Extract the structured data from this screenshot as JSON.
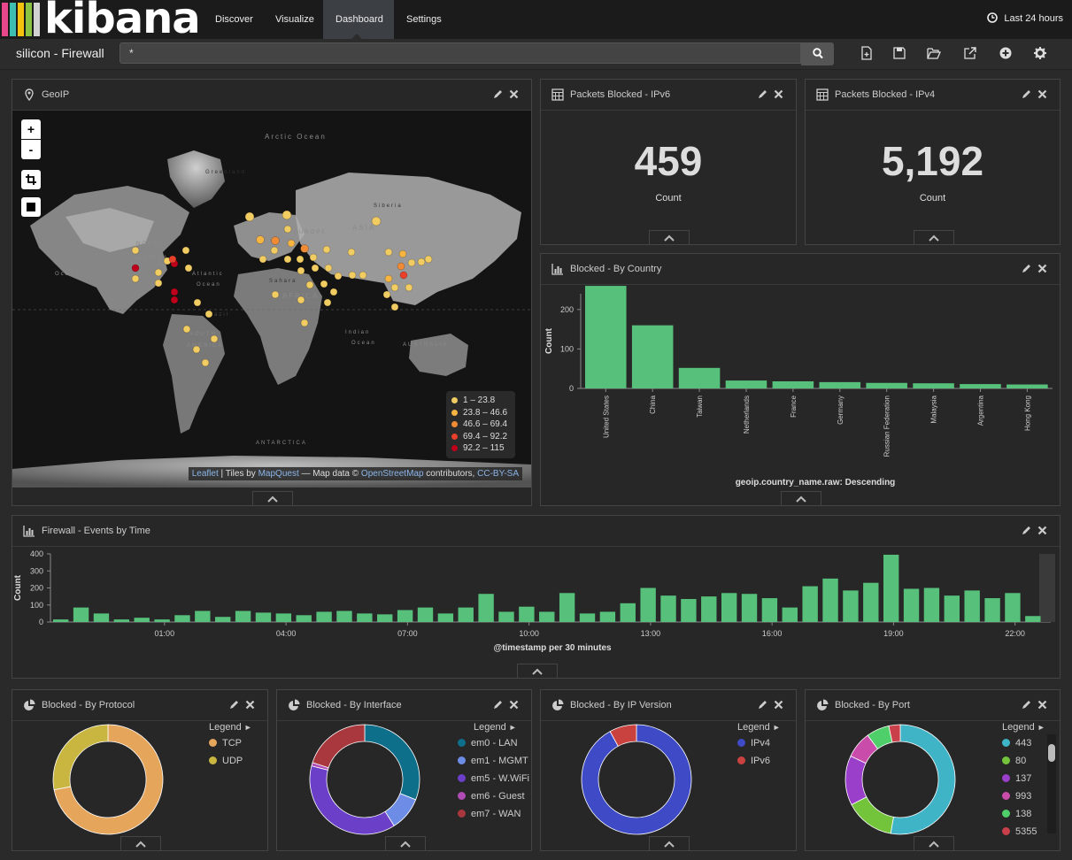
{
  "app": {
    "logo_text": "kibana",
    "logo_colors": [
      "#e8488b",
      "#3ebeb0",
      "#f4c20d",
      "#8ac341",
      "#d2d2d2"
    ]
  },
  "nav": {
    "items": [
      {
        "label": "Discover"
      },
      {
        "label": "Visualize"
      },
      {
        "label": "Dashboard"
      },
      {
        "label": "Settings"
      }
    ],
    "active": "Dashboard",
    "time": "Last 24 hours"
  },
  "dashboard": {
    "title": "silicon - Firewall",
    "query": "*"
  },
  "panels": {
    "geoip": {
      "title": "GeoIP",
      "map_labels": [
        "Arctic Ocean",
        "Greenland",
        "NORTH",
        "AMERICA",
        "Pacific",
        "Ocean",
        "Atlantic",
        "Ocean",
        "EUROPE",
        "ASIA",
        "Siberia",
        "AFRICA",
        "SOUTH",
        "AMERICA",
        "Indian",
        "Ocean",
        "AUSTRALIA",
        "ANTARCTICA",
        "Sahara",
        "Brazil"
      ],
      "legend": [
        "1 – 23.8",
        "23.8 – 46.6",
        "46.6 – 69.4",
        "69.4 – 92.2",
        "92.2 – 115"
      ],
      "legend_colors": [
        "#f1cc62",
        "#f6b443",
        "#f08a35",
        "#e8402a",
        "#c0001a"
      ],
      "zoom_in": "+",
      "zoom_out": "-",
      "attribution": {
        "leaflet": "Leaflet",
        "tiles_by": " | Tiles by ",
        "mapquest": "MapQuest",
        "map_data": " — Map data © ",
        "osm": "OpenStreetMap",
        "contributors": " contributors, ",
        "license": "CC-BY-SA"
      }
    },
    "ipv6": {
      "title": "Packets Blocked - IPv6",
      "value": "459",
      "label": "Count"
    },
    "ipv4": {
      "title": "Packets Blocked - IPv4",
      "value": "5,192",
      "label": "Count"
    },
    "country": {
      "title": "Blocked - By Country"
    },
    "events": {
      "title": "Firewall - Events by Time"
    },
    "protocol": {
      "title": "Blocked - By Protocol",
      "legend_title": "Legend",
      "legend": [
        "TCP",
        "UDP"
      ]
    },
    "interface": {
      "title": "Blocked - By Interface",
      "legend_title": "Legend",
      "legend": [
        "em0 - LAN",
        "em1 - MGMT",
        "em5 - W.WiFi",
        "em6 - Guest",
        "em7 - WAN"
      ]
    },
    "ipversion": {
      "title": "Blocked - By IP Version",
      "legend_title": "Legend",
      "legend": [
        "IPv4",
        "IPv6"
      ]
    },
    "port": {
      "title": "Blocked - By Port",
      "legend_title": "Legend",
      "legend": [
        "443",
        "80",
        "137",
        "993",
        "138",
        "5355"
      ]
    }
  },
  "chart_data": [
    {
      "type": "bar",
      "title": "Blocked - By Country",
      "categories": [
        "United States",
        "China",
        "Taiwan",
        "Netherlands",
        "France",
        "Germany",
        "Russian Federation",
        "Malaysia",
        "Argentina",
        "Hong Kong"
      ],
      "values": [
        260,
        160,
        52,
        20,
        18,
        16,
        14,
        13,
        11,
        10
      ],
      "xlabel": "geoip.country_name.raw: Descending",
      "ylabel": "Count",
      "ylim": [
        0,
        240
      ],
      "yticks": [
        0,
        100,
        200
      ],
      "color": "#57c17b"
    },
    {
      "type": "bar",
      "title": "Firewall - Events by Time",
      "x_ticks": [
        "01:00",
        "04:00",
        "07:00",
        "10:00",
        "13:00",
        "16:00",
        "19:00",
        "22:00"
      ],
      "values": [
        15,
        85,
        50,
        15,
        25,
        15,
        40,
        65,
        30,
        65,
        55,
        50,
        40,
        60,
        65,
        50,
        45,
        70,
        85,
        50,
        85,
        165,
        60,
        90,
        60,
        170,
        50,
        60,
        110,
        200,
        155,
        135,
        150,
        170,
        165,
        140,
        85,
        210,
        255,
        185,
        230,
        395,
        195,
        200,
        155,
        185,
        140,
        170,
        35
      ],
      "xlabel": "@timestamp per 30 minutes",
      "ylabel": "Count",
      "ylim": [
        0,
        400
      ],
      "yticks": [
        0,
        100,
        200,
        300,
        400
      ],
      "color": "#57c17b"
    },
    {
      "type": "pie",
      "title": "Blocked - By Protocol",
      "labels": [
        "TCP",
        "UDP"
      ],
      "values": [
        72,
        28
      ],
      "colors": [
        "#e5a55a",
        "#c9b640"
      ]
    },
    {
      "type": "pie",
      "title": "Blocked - By Interface",
      "labels": [
        "em0 - LAN",
        "em1 - MGMT",
        "em5 - W.WiFi",
        "em6 - Guest",
        "em7 - WAN"
      ],
      "values": [
        31,
        10,
        38,
        1,
        20
      ],
      "colors": [
        "#0e6f8b",
        "#6d8ce6",
        "#6c3fc9",
        "#b04bb5",
        "#a8383d"
      ]
    },
    {
      "type": "pie",
      "title": "Blocked - By IP Version",
      "labels": [
        "IPv4",
        "IPv6"
      ],
      "values": [
        92,
        8
      ],
      "colors": [
        "#3f4bc6",
        "#c9423f"
      ]
    },
    {
      "type": "pie",
      "title": "Blocked - By Port",
      "labels": [
        "443",
        "80",
        "137",
        "993",
        "138",
        "5355"
      ],
      "values": [
        47,
        13,
        13,
        7,
        6,
        3
      ],
      "colors": [
        "#3fb4c6",
        "#74c43b",
        "#9a3fc9",
        "#c94baa",
        "#4fcf6a",
        "#c93f4a"
      ]
    }
  ]
}
